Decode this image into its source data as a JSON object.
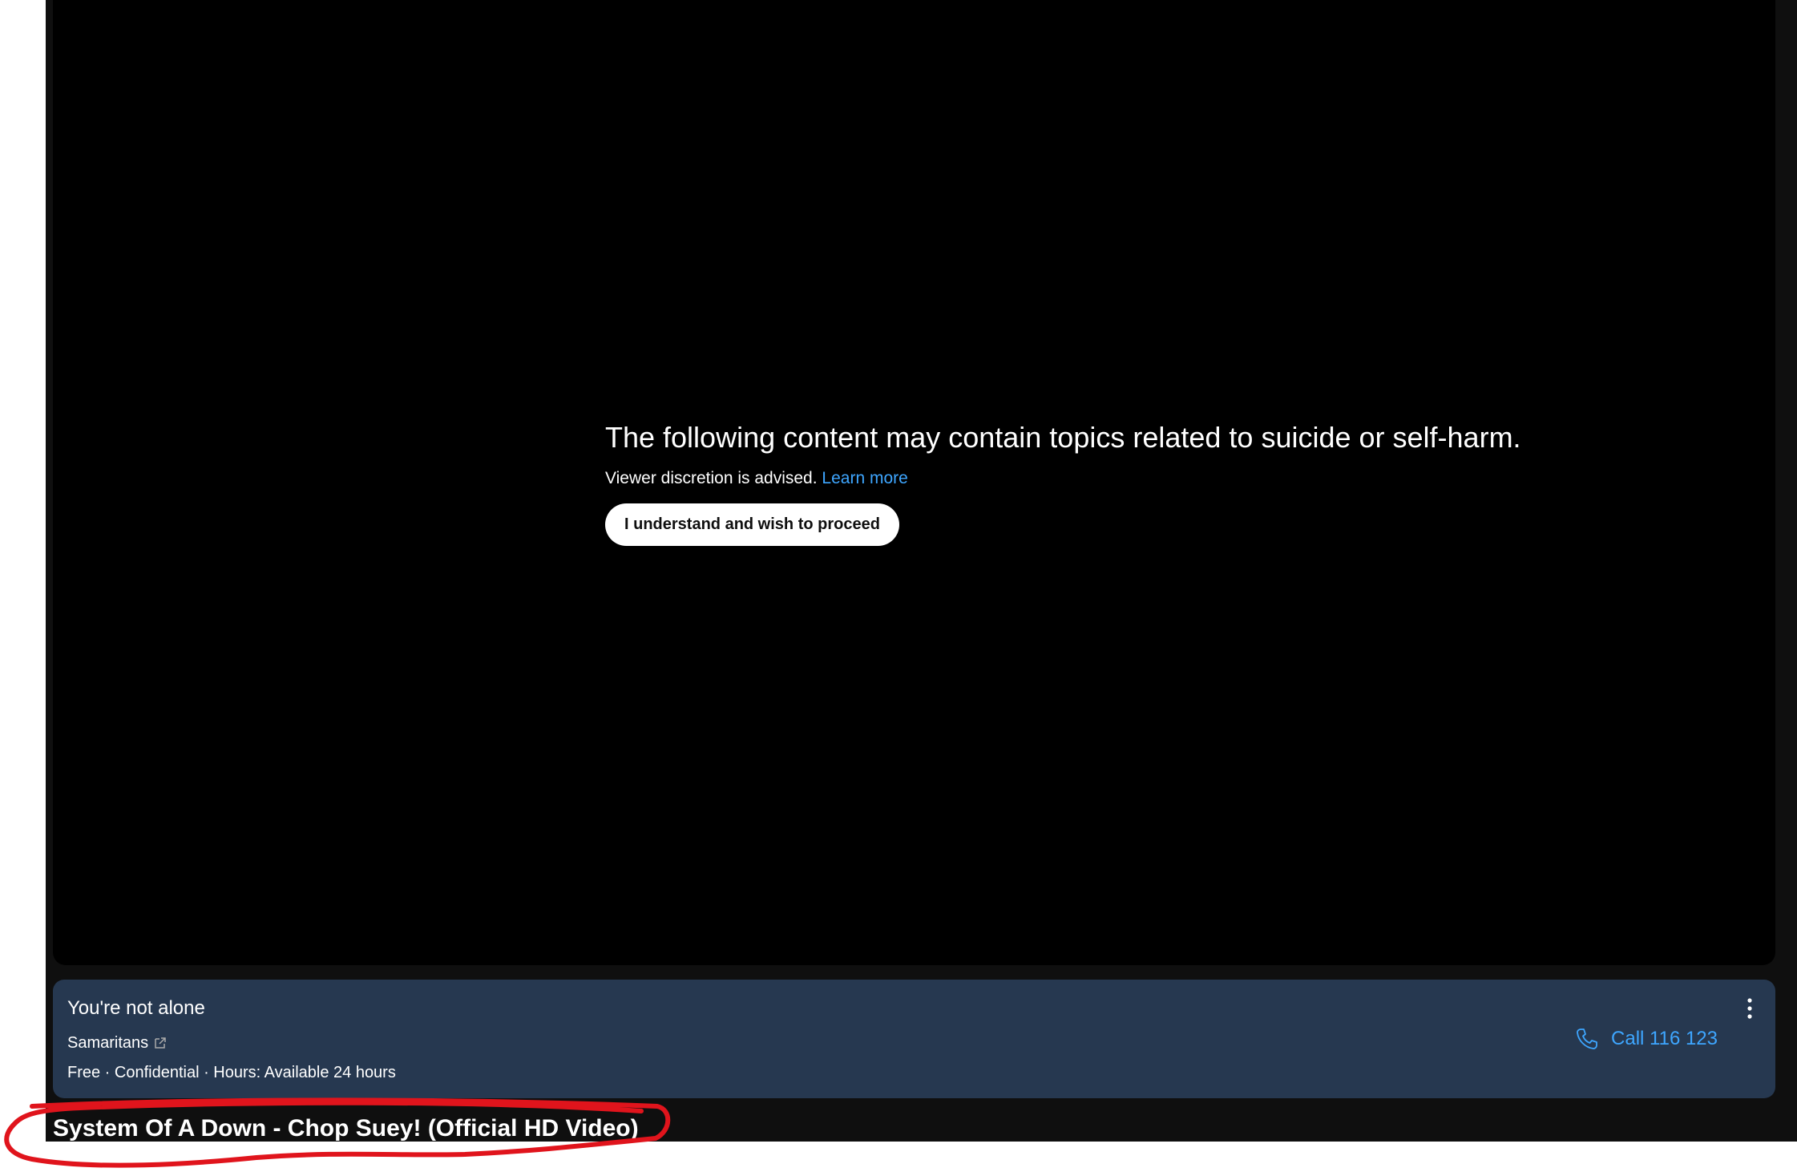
{
  "warning": {
    "title": "The following content may contain topics related to suicide or self-harm.",
    "subtitle": "Viewer discretion is advised.",
    "learn_more": "Learn more",
    "proceed_label": "I understand and wish to proceed"
  },
  "crisis_panel": {
    "heading": "You're not alone",
    "organization": "Samaritans",
    "details": "Free · Confidential · Hours: Available 24 hours",
    "call_label": "Call 116 123"
  },
  "video": {
    "title": "System Of A Down - Chop Suey! (Official HD Video)"
  },
  "icons": {
    "external_link": "external-link-icon",
    "more": "more-vert-icon",
    "phone": "phone-icon"
  },
  "colors": {
    "background": "#0f0f0f",
    "player": "#000000",
    "panel": "#263850",
    "link": "#3ea6ff",
    "annotation": "#e0141c"
  }
}
